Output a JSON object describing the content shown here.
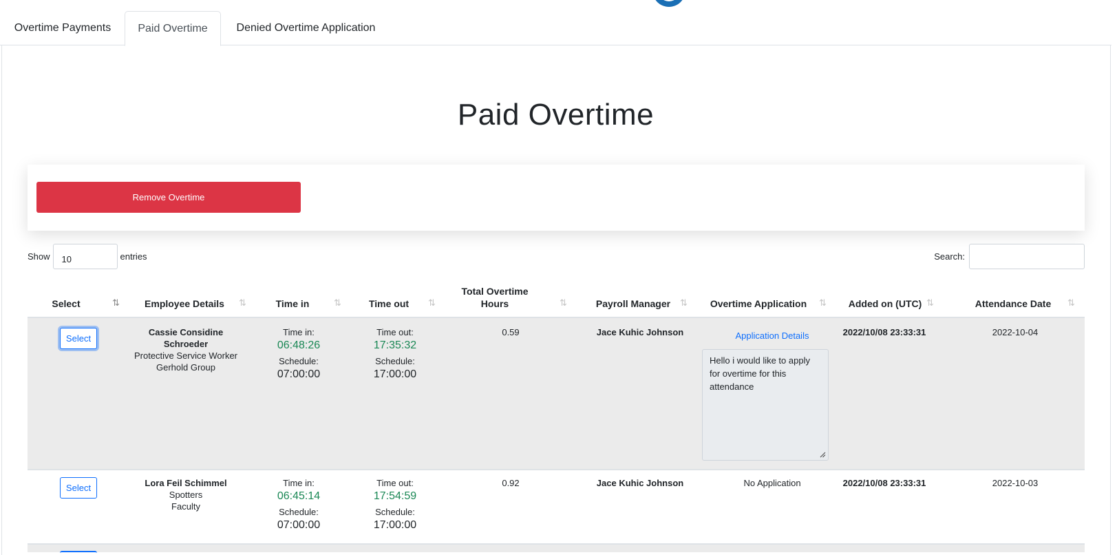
{
  "tabs": [
    {
      "label": "Overtime Payments",
      "active": false
    },
    {
      "label": "Paid Overtime",
      "active": true
    },
    {
      "label": "Denied Overtime Application",
      "active": false
    }
  ],
  "page_title": "Paid Overtime",
  "remove_button_label": "Remove Overtime",
  "length_menu": {
    "show_label": "Show",
    "value": "10",
    "entries_label": "entries"
  },
  "search": {
    "label": "Search:",
    "value": ""
  },
  "columns": [
    "Select",
    "Employee Details",
    "Time in",
    "Time out",
    "Total Overtime Hours",
    "Payroll Manager",
    "Overtime Application",
    "Added on (UTC)",
    "Attendance Date"
  ],
  "rows": [
    {
      "select_label": "Select",
      "employee_name": "Cassie Considine Schroeder",
      "employee_position": "Protective Service Worker",
      "employee_company": "Gerhold Group",
      "time_in_label": "Time in:",
      "time_in": "06:48:26",
      "time_in_schedule_label": "Schedule:",
      "time_in_schedule": "07:00:00",
      "time_out_label": "Time out:",
      "time_out": "17:35:32",
      "time_out_schedule_label": "Schedule:",
      "time_out_schedule": "17:00:00",
      "total_hours": "0.59",
      "payroll_manager": "Jace Kuhic Johnson",
      "application_link": "Application Details",
      "application_text": "Hello i would like to apply for overtime for this attendance",
      "added_on": "2022/10/08 23:33:31",
      "attendance_date": "2022-10-04"
    },
    {
      "select_label": "Select",
      "employee_name": "Lora Feil Schimmel",
      "employee_position": "Spotters",
      "employee_company": "Faculty",
      "time_in_label": "Time in:",
      "time_in": "06:45:14",
      "time_in_schedule_label": "Schedule:",
      "time_in_schedule": "07:00:00",
      "time_out_label": "Time out:",
      "time_out": "17:54:59",
      "time_out_schedule_label": "Schedule:",
      "time_out_schedule": "17:00:00",
      "total_hours": "0.92",
      "payroll_manager": "Jace Kuhic Johnson",
      "application_status": "No Application",
      "added_on": "2022/10/08 23:33:31",
      "attendance_date": "2022-10-03"
    }
  ],
  "colors": {
    "danger": "#dc3545",
    "primary": "#0d6efd",
    "success": "#198754",
    "brand": "#1a6fb5"
  }
}
